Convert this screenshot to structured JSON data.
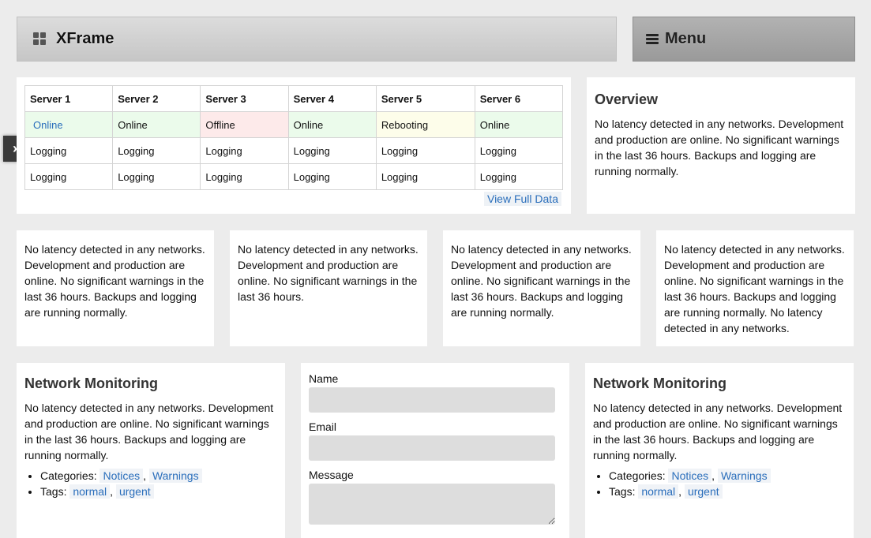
{
  "brand": {
    "title": "XFrame"
  },
  "menu": {
    "label": "Menu"
  },
  "servers": {
    "headers": [
      "Server 1",
      "Server 2",
      "Server 3",
      "Server 4",
      "Server 5",
      "Server 6"
    ],
    "status": [
      "Online",
      "Online",
      "Offline",
      "Online",
      "Rebooting",
      "Online"
    ],
    "row2": [
      "Logging",
      "Logging",
      "Logging",
      "Logging",
      "Logging",
      "Logging"
    ],
    "row3": [
      "Logging",
      "Logging",
      "Logging",
      "Logging",
      "Logging",
      "Logging"
    ],
    "view_full": "View Full Data"
  },
  "overview": {
    "title": "Overview",
    "text": "No latency detected in any networks. Development and production are online. No significant warnings in the last 36 hours. Backups and logging are running normally."
  },
  "mini": [
    "No latency detected in any networks. Development and production are online. No significant warnings in the last 36 hours. Backups and logging are running normally.",
    "No latency detected in any networks. Development and production are online. No significant warnings in the last 36 hours.",
    "No latency detected in any networks. Development and production are online. No significant warnings in the last 36 hours. Backups and logging are running normally.",
    "No latency detected in any networks. Development and production are online. No significant warnings in the last 36 hours. Backups and logging are running normally. No latency detected in any networks."
  ],
  "network": {
    "title": "Network Monitoring",
    "text": "No latency detected in any networks. Development and production are online. No significant warnings in the last 36 hours. Backups and logging are running normally.",
    "categories_label": "Categories:",
    "categories": [
      "Notices",
      "Warnings"
    ],
    "tags_label": "Tags:",
    "tags": [
      "normal",
      "urgent"
    ],
    "separator": ","
  },
  "form": {
    "name_label": "Name",
    "email_label": "Email",
    "message_label": "Message"
  }
}
